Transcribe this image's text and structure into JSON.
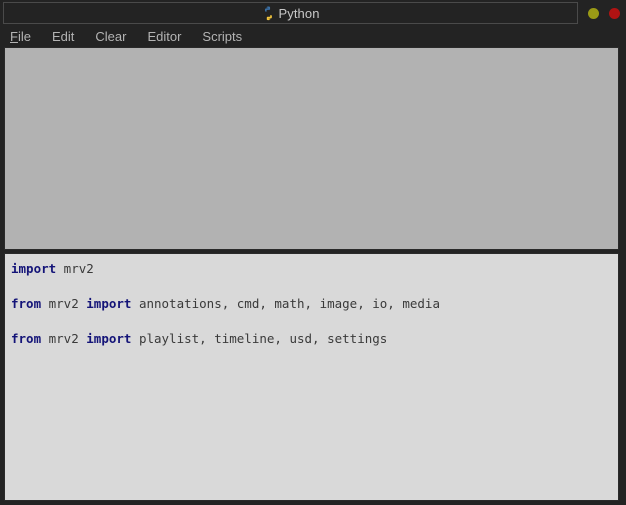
{
  "window": {
    "title": "Python",
    "icon": "python-logo-icon",
    "controls": [
      {
        "name": "minimize-button",
        "color": "#9a9a16"
      },
      {
        "name": "close-button",
        "color": "#b01313"
      }
    ]
  },
  "menubar": {
    "items": [
      {
        "label": "File",
        "mnemonic": "F"
      },
      {
        "label": "Edit",
        "mnemonic": ""
      },
      {
        "label": "Clear",
        "mnemonic": ""
      },
      {
        "label": "Editor",
        "mnemonic": ""
      },
      {
        "label": "Scripts",
        "mnemonic": ""
      }
    ]
  },
  "output_pane": {
    "content": ""
  },
  "editor_pane": {
    "lines": [
      {
        "tokens": [
          {
            "text": "import",
            "type": "keyword"
          },
          {
            "text": " mrv2",
            "type": "plain"
          }
        ]
      },
      {
        "tokens": [
          {
            "text": "from",
            "type": "keyword"
          },
          {
            "text": " mrv2 ",
            "type": "plain"
          },
          {
            "text": "import",
            "type": "keyword"
          },
          {
            "text": " annotations, cmd, math, image, io, media",
            "type": "plain"
          }
        ]
      },
      {
        "tokens": [
          {
            "text": "from",
            "type": "keyword"
          },
          {
            "text": " mrv2 ",
            "type": "plain"
          },
          {
            "text": "import",
            "type": "keyword"
          },
          {
            "text": " playlist, timeline, usd, settings",
            "type": "plain"
          }
        ]
      }
    ]
  },
  "colors": {
    "window_bg": "#232323",
    "menu_text": "#b4b4b4",
    "title_text": "#c8c8c8",
    "output_bg": "#b2b2b2",
    "editor_bg": "#d9d9d9",
    "keyword": "#141478",
    "code_text": "#3a3a3a"
  }
}
